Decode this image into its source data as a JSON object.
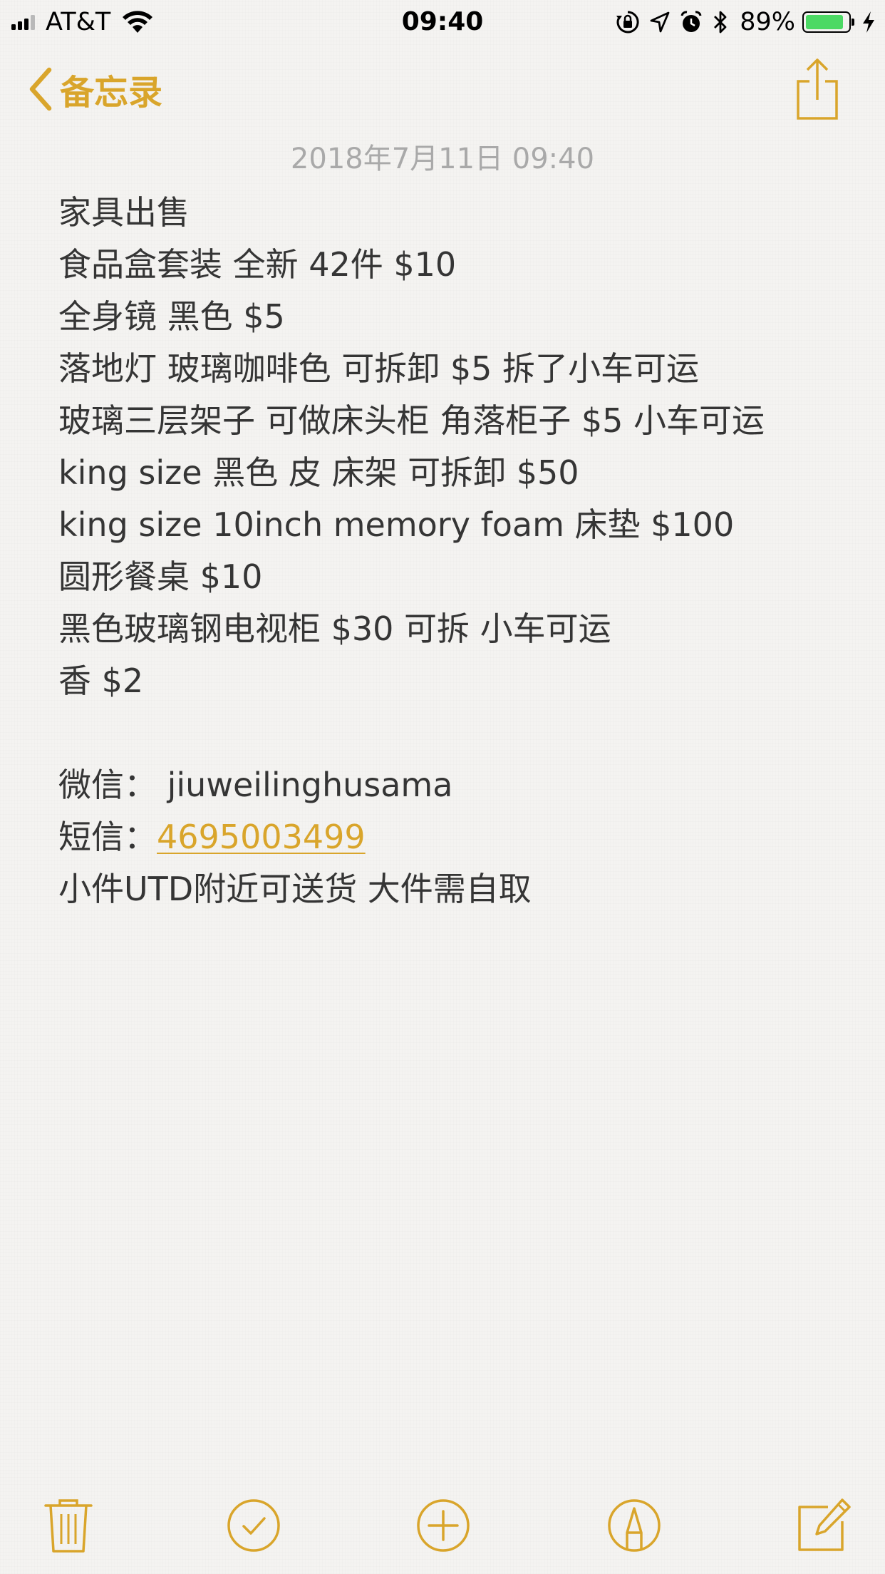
{
  "status_bar": {
    "carrier": "AT&T",
    "time": "09:40",
    "battery_percent": "89%",
    "battery_level": 0.89,
    "icons": [
      "cellular-signal-icon",
      "wifi-icon",
      "rotation-lock-icon",
      "location-icon",
      "alarm-icon",
      "bluetooth-icon",
      "battery-icon",
      "charging-icon"
    ]
  },
  "nav": {
    "back_label": "备忘录",
    "back_icon": "chevron-left-icon",
    "share_icon": "share-icon"
  },
  "note": {
    "date": "2018年7月11日 09:40",
    "lines": [
      "家具出售",
      "食品盒套装 全新 42件 $10",
      "全身镜 黑色 $5",
      "落地灯 玻璃咖啡色 可拆卸 $5 拆了小车可运",
      "玻璃三层架子 可做床头柜 角落柜子 $5 小车可运",
      "king size 黑色 皮 床架 可拆卸 $50",
      "king size 10inch memory foam 床垫 $100",
      "圆形餐桌 $10",
      "黑色玻璃钢电视柜 $30 可拆 小车可运",
      "香 $2",
      "",
      "微信： jiuweilinghusama"
    ],
    "sms_label": "短信：",
    "sms_number": "4695003499",
    "last_line": "小件UTD附近可送货 大件需自取"
  },
  "toolbar": {
    "items": [
      "trash-icon",
      "checklist-icon",
      "add-icon",
      "markup-icon",
      "compose-icon"
    ]
  },
  "colors": {
    "accent": "#d9a52b",
    "text": "#353535",
    "date": "#a9a9a9",
    "background": "#f4f3f1",
    "battery": "#4cd964"
  }
}
